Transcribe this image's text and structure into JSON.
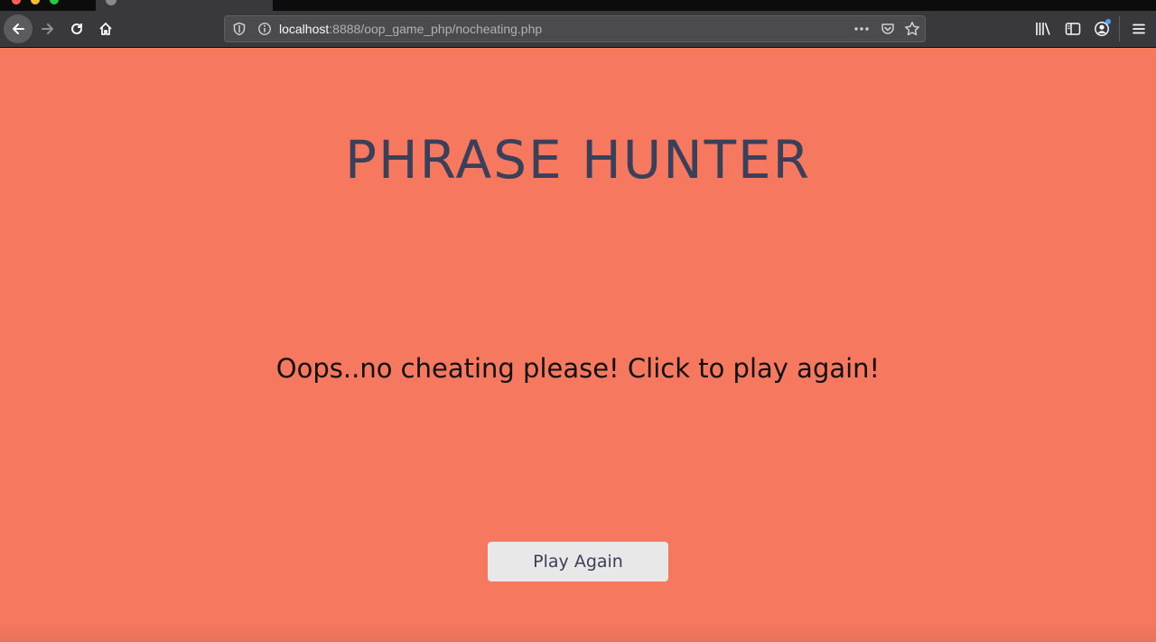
{
  "browser": {
    "address_bar": {
      "host": "localhost",
      "path": ":8888/oop_game_php/nocheating.php"
    }
  },
  "icons": {
    "back": "back-arrow-icon",
    "forward": "forward-arrow-icon",
    "reload": "reload-icon",
    "home": "home-icon",
    "tracking_protection": "shield-icon",
    "site_info": "info-icon",
    "page_actions": "more-horizontal-icon",
    "pocket": "pocket-icon",
    "bookmark": "star-icon",
    "library": "library-icon",
    "sidebar": "sidebar-icon",
    "account": "account-icon",
    "menu": "hamburger-menu-icon"
  },
  "page": {
    "title": "PHRASE HUNTER",
    "message": "Oops..no cheating please! Click to play again!",
    "play_again_label": "Play Again"
  },
  "colors": {
    "background": "#f6785f",
    "title": "#3a405a",
    "button_bg": "#e8e8e8",
    "browser_toolbar": "#38383d"
  }
}
